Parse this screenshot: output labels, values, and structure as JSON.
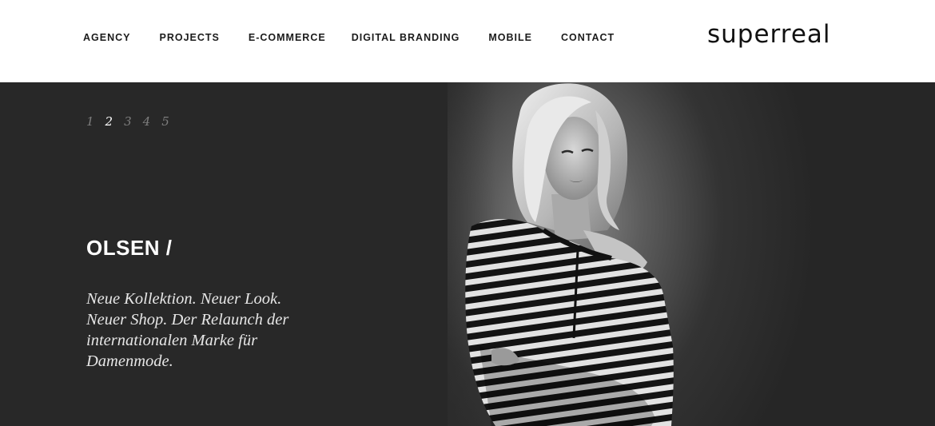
{
  "nav": {
    "items": [
      "AGENCY",
      "PROJECTS",
      "E-COMMERCE",
      "DIGITAL BRANDING",
      "MOBILE",
      "CONTACT"
    ]
  },
  "logo": {
    "text": "superreal"
  },
  "hero": {
    "pager": [
      "1",
      "2",
      "3",
      "4",
      "5"
    ],
    "active_page": "2",
    "title": "OLSEN /",
    "description_lines": [
      "Neue Kollektion. Neuer Look.",
      "Neuer Shop. Der Relaunch der",
      "internationalen Marke für",
      "Damenmode."
    ],
    "image": "model-photo"
  },
  "colors": {
    "header_bg": "#ffffff",
    "hero_bg": "#282828",
    "text_light": "#ffffff",
    "pager_inactive": "#7d7d7d"
  }
}
